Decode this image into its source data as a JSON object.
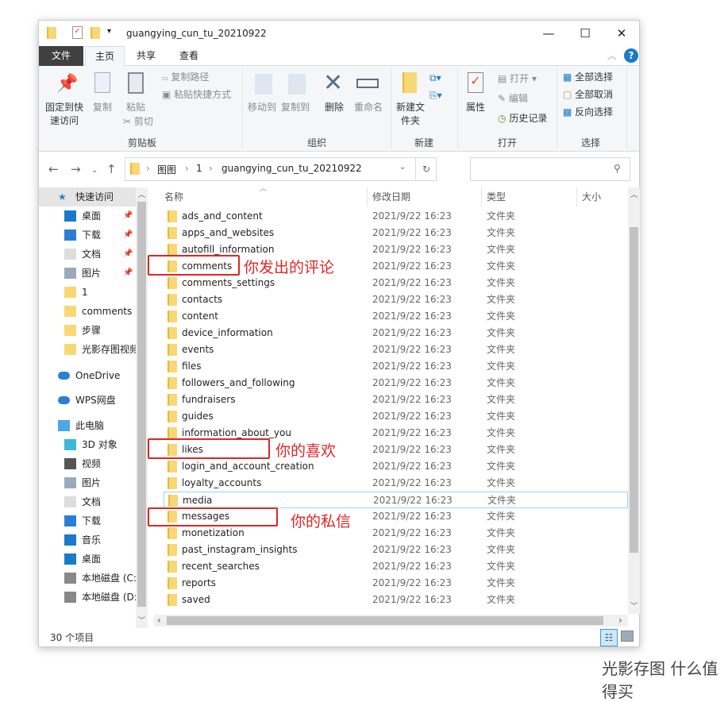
{
  "window": {
    "title": "guangying_cun_tu_20210922",
    "min": "—",
    "max": "☐",
    "close": "✕"
  },
  "tabs": [
    "文件",
    "主页",
    "共享",
    "查看"
  ],
  "ribbon": {
    "clipboard": {
      "pin": "固定到快速访问",
      "copy": "复制",
      "paste": "粘贴",
      "copy_path": "复制路径",
      "paste_shortcut": "粘贴快捷方式",
      "cut": "剪切",
      "group": "剪贴板"
    },
    "organize": {
      "move_to": "移动到",
      "copy_to": "复制到",
      "delete": "删除",
      "rename": "重命名",
      "group": "组织"
    },
    "new": {
      "new_folder": "新建文件夹",
      "group": "新建"
    },
    "open": {
      "properties": "属性",
      "open": "打开",
      "edit": "编辑",
      "history": "历史记录",
      "group": "打开"
    },
    "select": {
      "select_all": "全部选择",
      "select_none": "全部取消",
      "invert": "反向选择",
      "group": "选择"
    }
  },
  "address": {
    "crumbs": [
      "图图",
      "1",
      "guangying_cun_tu_20210922"
    ],
    "search_placeholder": ""
  },
  "sidebar": [
    {
      "label": "快速访问",
      "icon": "star-icon"
    },
    {
      "label": "桌面",
      "icon": "desktop-icon",
      "pinned": true
    },
    {
      "label": "下载",
      "icon": "download-icon",
      "pinned": true
    },
    {
      "label": "文档",
      "icon": "document-icon",
      "pinned": true
    },
    {
      "label": "图片",
      "icon": "pictures-icon",
      "pinned": true
    },
    {
      "label": "1",
      "icon": "folder-icon"
    },
    {
      "label": "comments",
      "icon": "folder-icon"
    },
    {
      "label": "步骤",
      "icon": "folder-icon"
    },
    {
      "label": "光影存图视频",
      "icon": "folder-icon"
    },
    {
      "label": "OneDrive",
      "icon": "cloud-icon"
    },
    {
      "label": "WPS网盘",
      "icon": "cloud-icon"
    },
    {
      "label": "此电脑",
      "icon": "computer-icon"
    },
    {
      "label": "3D 对象",
      "icon": "cube-icon"
    },
    {
      "label": "视频",
      "icon": "video-icon"
    },
    {
      "label": "图片",
      "icon": "pictures-icon"
    },
    {
      "label": "文档",
      "icon": "document-icon"
    },
    {
      "label": "下载",
      "icon": "download-icon"
    },
    {
      "label": "音乐",
      "icon": "music-icon"
    },
    {
      "label": "桌面",
      "icon": "desktop-icon"
    },
    {
      "label": "本地磁盘 (C:)",
      "icon": "drive-icon"
    },
    {
      "label": "本地磁盘 (D:)",
      "icon": "drive-icon"
    }
  ],
  "columns": [
    "名称",
    "修改日期",
    "类型",
    "大小"
  ],
  "files": [
    {
      "name": "ads_and_content"
    },
    {
      "name": "apps_and_websites"
    },
    {
      "name": "autofill_information"
    },
    {
      "name": "comments"
    },
    {
      "name": "comments_settings"
    },
    {
      "name": "contacts"
    },
    {
      "name": "content"
    },
    {
      "name": "device_information"
    },
    {
      "name": "events"
    },
    {
      "name": "files"
    },
    {
      "name": "followers_and_following"
    },
    {
      "name": "fundraisers"
    },
    {
      "name": "guides"
    },
    {
      "name": "information_about_you"
    },
    {
      "name": "likes"
    },
    {
      "name": "login_and_account_creation"
    },
    {
      "name": "loyalty_accounts"
    },
    {
      "name": "media"
    },
    {
      "name": "messages"
    },
    {
      "name": "monetization"
    },
    {
      "name": "past_instagram_insights"
    },
    {
      "name": "recent_searches"
    },
    {
      "name": "reports"
    },
    {
      "name": "saved"
    }
  ],
  "file_date": "2021/9/22 16:23",
  "file_type": "文件夹",
  "annotations": {
    "comments": "你发出的评论",
    "likes": "你的喜欢",
    "messages": "你的私信"
  },
  "status": {
    "count": "30 个项目"
  },
  "watermark": "光影存图 什么值得买",
  "colors": {
    "accent": "#1979ca",
    "annotation": "#e02525",
    "folder": "#f8d775"
  }
}
